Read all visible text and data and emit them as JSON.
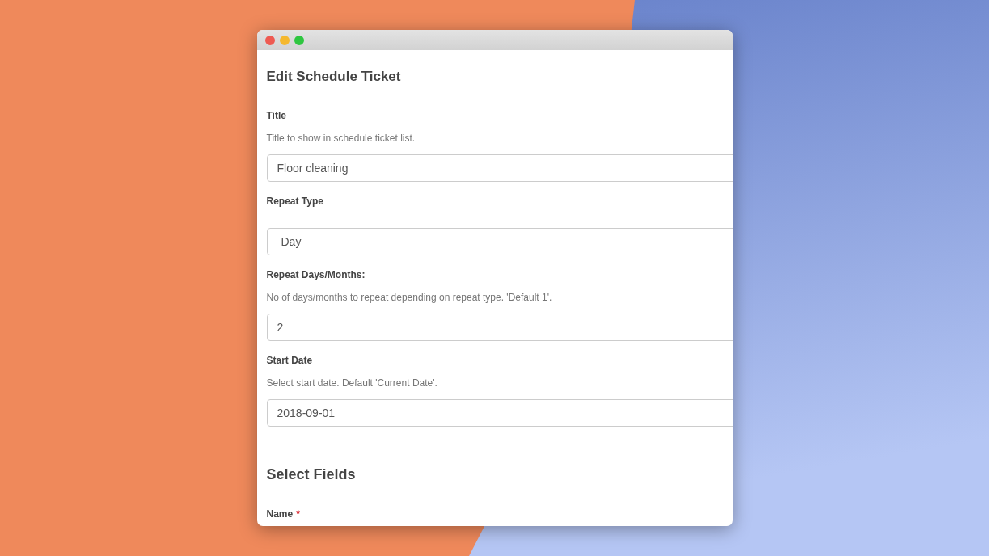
{
  "window": {
    "controls": [
      {
        "kind": "close"
      },
      {
        "kind": "minimize"
      },
      {
        "kind": "maximize"
      }
    ]
  },
  "page": {
    "title": "Edit Schedule Ticket"
  },
  "fields": [
    {
      "kind": "text",
      "label": "Title",
      "hint": "Title to show in schedule ticket list.",
      "value": "Floor cleaning"
    },
    {
      "kind": "select",
      "label": "Repeat Type",
      "value": "Day"
    },
    {
      "kind": "text",
      "label": "Repeat Days/Months:",
      "hint": "No of days/months to repeat depending on repeat type. 'Default 1'.",
      "value": "2"
    },
    {
      "kind": "text",
      "label": "Start Date",
      "hint": "Select start date. Default 'Current Date'.",
      "value": "2018-09-01"
    }
  ],
  "section": {
    "title": "Select Fields",
    "fields": [
      {
        "label": "Name",
        "required_mark": "*"
      }
    ]
  }
}
